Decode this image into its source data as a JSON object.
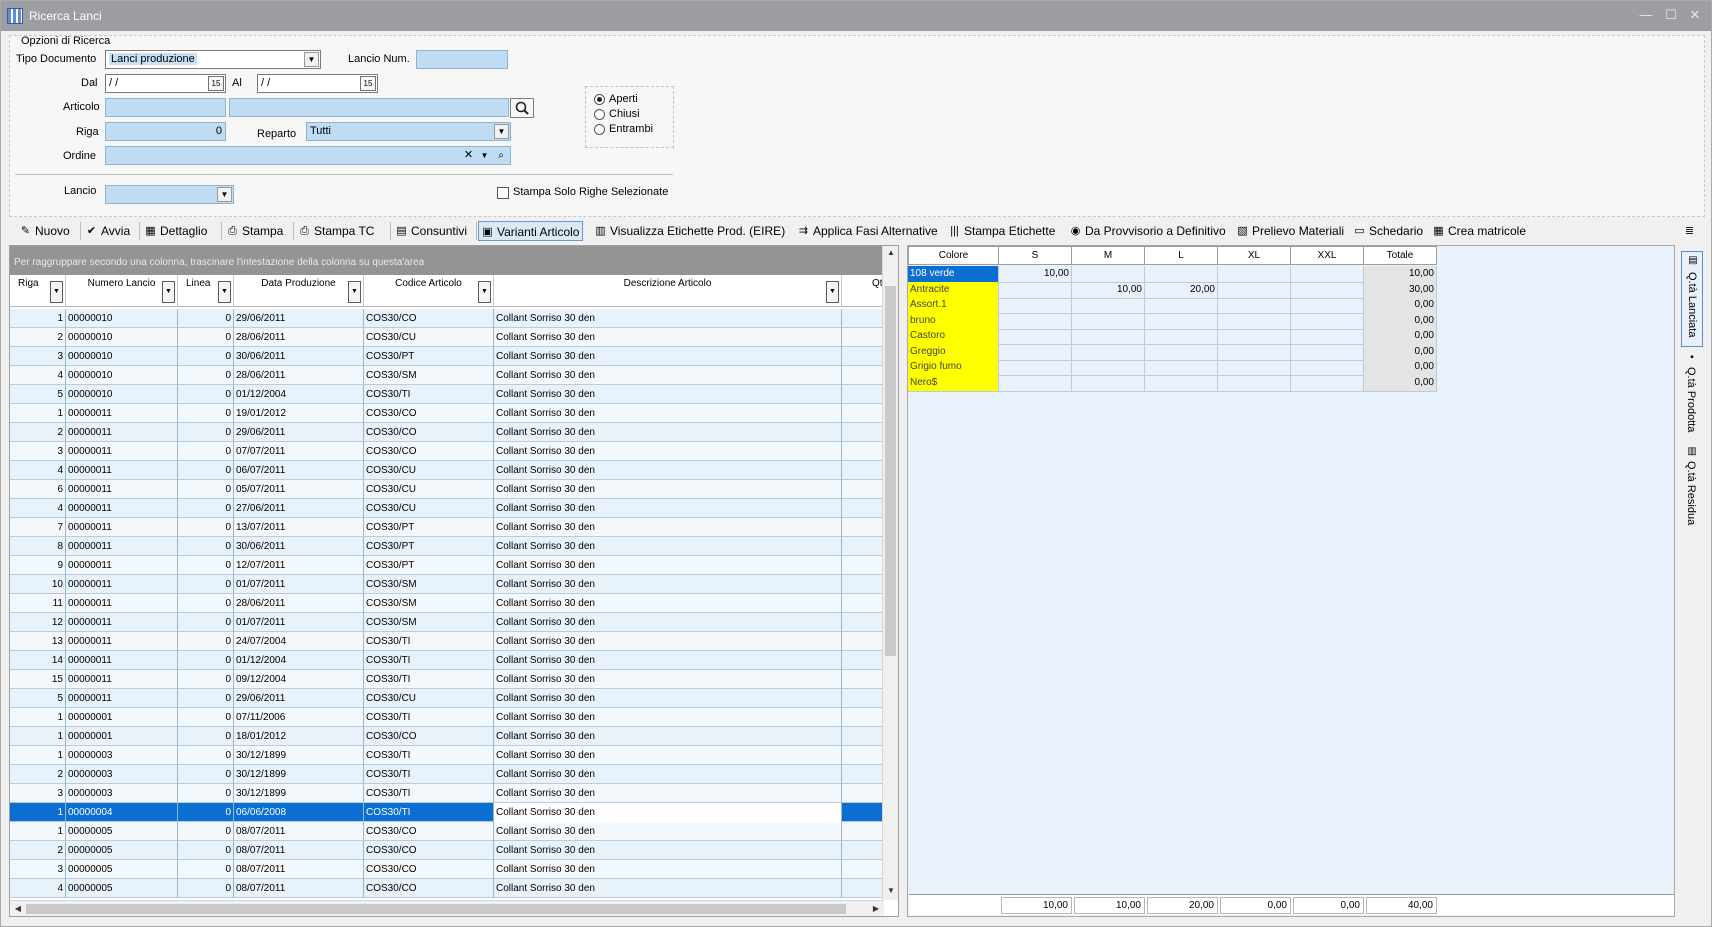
{
  "window": {
    "title": "Ricerca Lanci",
    "minimize": "—",
    "maximize": "☐",
    "close": "✕"
  },
  "options": {
    "section_title": "Opzioni di Ricerca",
    "tipo_documento_label": "Tipo Documento",
    "tipo_documento_value": "Lanci produzione",
    "lancio_num_label": "Lancio Num.",
    "lancio_num_value": "",
    "dal_label": "Dal",
    "dal_value": " / /",
    "al_label": "Al",
    "al_value": " / /",
    "articolo_label": "Articolo",
    "articolo_code": "",
    "articolo_desc": "",
    "riga_label": "Riga",
    "riga_value": "0",
    "reparto_label": "Reparto",
    "reparto_value": "Tutti",
    "ordine_label": "Ordine",
    "ordine_value": "",
    "lancio_label": "Lancio",
    "lancio_value": "",
    "stato": {
      "aperti": "Aperti",
      "chiusi": "Chiusi",
      "entrambi": "Entrambi",
      "selected": "aperti"
    },
    "stampa_solo_label": "Stampa Solo Righe Selezionate"
  },
  "toolbar": {
    "nuovo": "Nuovo",
    "avvia": "Avvia",
    "dettaglio": "Dettaglio",
    "stampa": "Stampa",
    "stampa_tc": "Stampa TC",
    "consuntivi": "Consuntivi",
    "varianti_articolo": "Varianti Articolo",
    "visualizza_etichette": "Visualizza Etichette Prod. (EIRE)",
    "applica_fasi": "Applica Fasi Alternative",
    "stampa_etichette": "Stampa Etichette",
    "da_provvisorio": "Da Provvisorio a Definitivo",
    "prelievo_materiali": "Prelievo Materiali",
    "schedario": "Schedario",
    "crea_matricole": "Crea matricole"
  },
  "main_grid": {
    "group_hint": "Per raggruppare secondo una colonna, trascinare l'intestazione della colonna su questa'area",
    "columns": [
      "Riga",
      "Numero Lancio",
      "Linea",
      "Data Produzione",
      "Codice Articolo",
      "Descrizione Articolo",
      "Qtà"
    ],
    "selected_index": 26,
    "rows": [
      [
        "1",
        "00000010",
        "0",
        "29/06/2011",
        "COS30/CO",
        "Collant Sorriso 30 den"
      ],
      [
        "2",
        "00000010",
        "0",
        "28/06/2011",
        "COS30/CU",
        "Collant Sorriso 30 den"
      ],
      [
        "3",
        "00000010",
        "0",
        "30/06/2011",
        "COS30/PT",
        "Collant Sorriso 30 den"
      ],
      [
        "4",
        "00000010",
        "0",
        "28/06/2011",
        "COS30/SM",
        "Collant Sorriso 30 den"
      ],
      [
        "5",
        "00000010",
        "0",
        "01/12/2004",
        "COS30/TI",
        "Collant Sorriso 30 den"
      ],
      [
        "1",
        "00000011",
        "0",
        "19/01/2012",
        "COS30/CO",
        "Collant Sorriso 30 den"
      ],
      [
        "2",
        "00000011",
        "0",
        "29/06/2011",
        "COS30/CO",
        "Collant Sorriso 30 den"
      ],
      [
        "3",
        "00000011",
        "0",
        "07/07/2011",
        "COS30/CO",
        "Collant Sorriso 30 den"
      ],
      [
        "4",
        "00000011",
        "0",
        "06/07/2011",
        "COS30/CU",
        "Collant Sorriso 30 den"
      ],
      [
        "6",
        "00000011",
        "0",
        "05/07/2011",
        "COS30/CU",
        "Collant Sorriso 30 den"
      ],
      [
        "4",
        "00000011",
        "0",
        "27/06/2011",
        "COS30/CU",
        "Collant Sorriso 30 den"
      ],
      [
        "7",
        "00000011",
        "0",
        "13/07/2011",
        "COS30/PT",
        "Collant Sorriso 30 den"
      ],
      [
        "8",
        "00000011",
        "0",
        "30/06/2011",
        "COS30/PT",
        "Collant Sorriso 30 den"
      ],
      [
        "9",
        "00000011",
        "0",
        "12/07/2011",
        "COS30/PT",
        "Collant Sorriso 30 den"
      ],
      [
        "10",
        "00000011",
        "0",
        "01/07/2011",
        "COS30/SM",
        "Collant Sorriso 30 den"
      ],
      [
        "11",
        "00000011",
        "0",
        "28/06/2011",
        "COS30/SM",
        "Collant Sorriso 30 den"
      ],
      [
        "12",
        "00000011",
        "0",
        "01/07/2011",
        "COS30/SM",
        "Collant Sorriso 30 den"
      ],
      [
        "13",
        "00000011",
        "0",
        "24/07/2004",
        "COS30/TI",
        "Collant Sorriso 30 den"
      ],
      [
        "14",
        "00000011",
        "0",
        "01/12/2004",
        "COS30/TI",
        "Collant Sorriso 30 den"
      ],
      [
        "15",
        "00000011",
        "0",
        "09/12/2004",
        "COS30/TI",
        "Collant Sorriso 30 den"
      ],
      [
        "5",
        "00000011",
        "0",
        "29/06/2011",
        "COS30/CU",
        "Collant Sorriso 30 den"
      ],
      [
        "1",
        "00000001",
        "0",
        "07/11/2006",
        "COS30/TI",
        "Collant Sorriso 30 den"
      ],
      [
        "1",
        "00000001",
        "0",
        "18/01/2012",
        "COS30/CO",
        "Collant Sorriso 30 den"
      ],
      [
        "1",
        "00000003",
        "0",
        "30/12/1899",
        "COS30/TI",
        "Collant Sorriso 30 den"
      ],
      [
        "2",
        "00000003",
        "0",
        "30/12/1899",
        "COS30/TI",
        "Collant Sorriso 30 den"
      ],
      [
        "3",
        "00000003",
        "0",
        "30/12/1899",
        "COS30/TI",
        "Collant Sorriso 30 den"
      ],
      [
        "1",
        "00000004",
        "0",
        "06/06/2008",
        "COS30/TI",
        "Collant Sorriso 30 den"
      ],
      [
        "1",
        "00000005",
        "0",
        "08/07/2011",
        "COS30/CO",
        "Collant Sorriso 30 den"
      ],
      [
        "2",
        "00000005",
        "0",
        "08/07/2011",
        "COS30/CO",
        "Collant Sorriso 30 den"
      ],
      [
        "3",
        "00000005",
        "0",
        "08/07/2011",
        "COS30/CO",
        "Collant Sorriso 30 den"
      ],
      [
        "4",
        "00000005",
        "0",
        "08/07/2011",
        "COS30/CO",
        "Collant Sorriso 30 den"
      ]
    ]
  },
  "variants_grid": {
    "columns": [
      "Colore",
      "S",
      "M",
      "L",
      "XL",
      "XXL",
      "Totale"
    ],
    "rows": [
      [
        "108 verde",
        "10,00",
        "",
        "",
        "",
        "",
        "10,00"
      ],
      [
        "Antracite",
        "",
        "10,00",
        "20,00",
        "",
        "",
        "30,00"
      ],
      [
        "Assort.1",
        "",
        "",
        "",
        "",
        "",
        "0,00"
      ],
      [
        "bruno",
        "",
        "",
        "",
        "",
        "",
        "0,00"
      ],
      [
        "Castoro",
        "",
        "",
        "",
        "",
        "",
        "0,00"
      ],
      [
        "Greggio",
        "",
        "",
        "",
        "",
        "",
        "0,00"
      ],
      [
        "Grigio fumo",
        "",
        "",
        "",
        "",
        "",
        "0,00"
      ],
      [
        "Nero$",
        "",
        "",
        "",
        "",
        "",
        "0,00"
      ]
    ],
    "totals": [
      "",
      "10,00",
      "10,00",
      "20,00",
      "0,00",
      "0,00",
      "40,00"
    ],
    "highlight_color": "#ffff00",
    "selection_color": "#0a6fd0"
  },
  "side_tabs": {
    "lanciata": "Q.tà Lanciata",
    "prodotta": "Q.tà Prodotta",
    "residua": "Q.tà Residua"
  }
}
